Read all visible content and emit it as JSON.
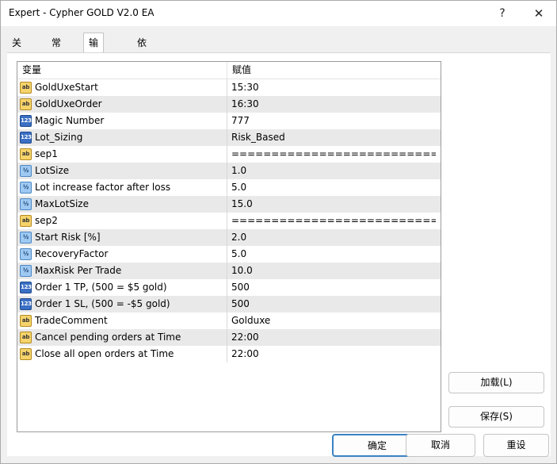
{
  "window": {
    "title": "Expert - Cypher GOLD V2.0 EA",
    "help_glyph": "?",
    "close_glyph": "✕"
  },
  "tabs": [
    {
      "label": "关于"
    },
    {
      "label": "常用"
    },
    {
      "label": "输入参数"
    },
    {
      "label": "依存关系"
    }
  ],
  "grid": {
    "col_variable": "变量",
    "col_value": "赋值",
    "rows": [
      {
        "type": "ab",
        "name": "GoldUxeStart",
        "value": "15:30"
      },
      {
        "type": "ab",
        "name": "GoldUxeOrder",
        "value": "16:30"
      },
      {
        "type": "123",
        "name": "Magic Number",
        "value": "777"
      },
      {
        "type": "123",
        "name": "Lot_Sizing",
        "value": "Risk_Based"
      },
      {
        "type": "ab",
        "name": "sep1",
        "value": "==============================..."
      },
      {
        "type": "v2",
        "name": "LotSize",
        "value": "1.0"
      },
      {
        "type": "v2",
        "name": "Lot increase factor after loss",
        "value": "5.0"
      },
      {
        "type": "v2",
        "name": "MaxLotSize",
        "value": "15.0"
      },
      {
        "type": "ab",
        "name": "sep2",
        "value": "==============================..."
      },
      {
        "type": "v2",
        "name": "Start Risk [%]",
        "value": "2.0"
      },
      {
        "type": "v2",
        "name": "RecoveryFactor",
        "value": "5.0"
      },
      {
        "type": "v2",
        "name": "MaxRisk Per Trade",
        "value": "10.0"
      },
      {
        "type": "123",
        "name": "Order 1 TP, (500 = $5 gold)",
        "value": "500"
      },
      {
        "type": "123",
        "name": "Order 1 SL, (500 = -$5 gold)",
        "value": "500"
      },
      {
        "type": "ab",
        "name": "TradeComment",
        "value": "Golduxe"
      },
      {
        "type": "ab",
        "name": "Cancel pending orders at Time",
        "value": "22:00"
      },
      {
        "type": "ab",
        "name": "Close all open orders at Time",
        "value": "22:00"
      }
    ]
  },
  "icons": {
    "ab": "ab",
    "123": "123",
    "v2": "½"
  },
  "buttons": {
    "load": "加载(L)",
    "save": "保存(S)",
    "ok": "确定",
    "cancel": "取消",
    "reset": "重设"
  }
}
